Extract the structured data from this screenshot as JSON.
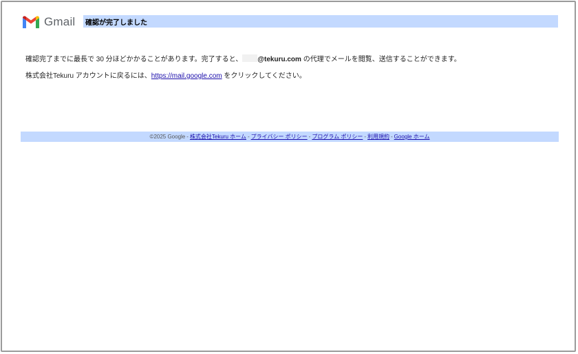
{
  "header": {
    "logo_icon": "gmail-m-icon",
    "logo_text": "Gmail",
    "title": "確認が完了しました"
  },
  "message": {
    "line1_before": "確認完了までに最長で 30 分ほどかかることがあります。完了すると、",
    "line1_email": "@tekuru.com",
    "line1_after": " の代理でメールを閲覧、送信することができます。",
    "line2_before": "株式会社Tekuru アカウントに戻るには、",
    "line2_link": "https://mail.google.com",
    "line2_after": " をクリックしてください。"
  },
  "footer": {
    "copyright": "©2025 Google",
    "separator": "-",
    "links": [
      "株式会社Tekuru ホーム",
      "プライバシー ポリシー",
      "プログラム ポリシー",
      "利用規約",
      "Google ホーム"
    ]
  },
  "colors": {
    "title_bar": "#c3d9ff",
    "footer_bar": "#c3d9ff",
    "link": "#1a0dab",
    "gmail_red": "#ea4335",
    "gmail_blue": "#4285f4",
    "gmail_green": "#34a853",
    "gmail_yellow": "#fbbc04"
  }
}
